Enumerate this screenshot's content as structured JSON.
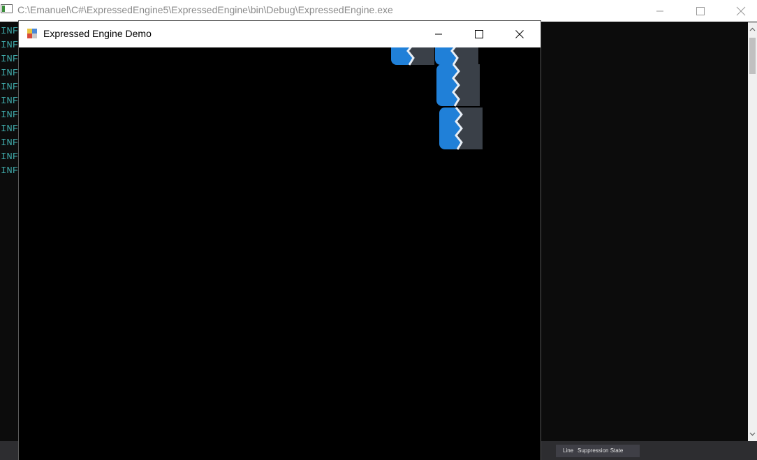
{
  "console": {
    "title": "C:\\Emanuel\\C#\\ExpressedEngine5\\ExpressedEngine\\bin\\Debug\\ExpressedEngine.exe",
    "lines": [
      "INF",
      "INF",
      "INF",
      "INF",
      "INF",
      "INF",
      "INF",
      "INF",
      "INF",
      "INF",
      "INF"
    ]
  },
  "demo": {
    "title": "Expressed Engine Demo"
  },
  "ide": {
    "col_line": "Line",
    "col_suppression": "Suppression State"
  },
  "colors": {
    "sprite_blue": "#2080d8",
    "sprite_dark": "#3a4048",
    "console_text": "#3fa8a8"
  },
  "icons": [
    "console-app-icon",
    "minimize-icon",
    "maximize-icon",
    "close-icon",
    "demo-app-icon",
    "scroll-up-icon",
    "scroll-down-icon"
  ]
}
